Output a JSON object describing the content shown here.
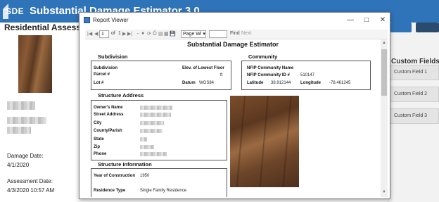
{
  "app": {
    "logo_text": "SDE",
    "title": "Substantial Damage Estimator 3.0"
  },
  "left_panel": {
    "title": "Residential Assessment",
    "damage_date_label": "Damage Date:",
    "damage_date_value": "4/1/2020",
    "assessment_date_label": "Assessment Date:",
    "assessment_date_value": "4/3/2020 10:57 AM"
  },
  "right_panel": {
    "custom_fields_title": "Custom Fields",
    "custom_fields": [
      "Custom Field 1",
      "Custom Field 2",
      "Custom Field 3"
    ]
  },
  "dialog": {
    "title": "Report Viewer",
    "toolbar": {
      "page_value": "1",
      "of_label": "of",
      "page_count": "1",
      "zoom_value": "Page Wi",
      "find_label": "Find",
      "next_label": "Next"
    }
  },
  "report": {
    "title": "Substantial Damage Estimator",
    "subdivision": {
      "heading": "Subdivision",
      "subdivision_label": "Subdivision",
      "parcel_label": "Parcel #",
      "lot_label": "Lot #",
      "elev_label": "Elev. of Lowest Floor",
      "elev_unit": "ft",
      "datum_label": "Datum",
      "datum_value": "WGS84"
    },
    "community": {
      "heading": "Community",
      "name_label": "NFIP Community Name",
      "id_label": "NFIP Community ID #",
      "id_value": "510147",
      "lat_label": "Latitude",
      "lat_value": "38.912144",
      "lon_label": "Longitude",
      "lon_value": "-78.461245"
    },
    "structure_address": {
      "heading": "Structure Address",
      "owner_label": "Owner's Name",
      "street_label": "Street Address",
      "city_label": "City",
      "county_label": "County/Parish",
      "state_label": "State",
      "zip_label": "Zip",
      "phone_label": "Phone"
    },
    "structure_info": {
      "heading": "Structure Information",
      "year_label": "Year of Construction",
      "year_value": "1950",
      "type_label": "Residence Type",
      "type_value": "Single Family Residence"
    }
  }
}
